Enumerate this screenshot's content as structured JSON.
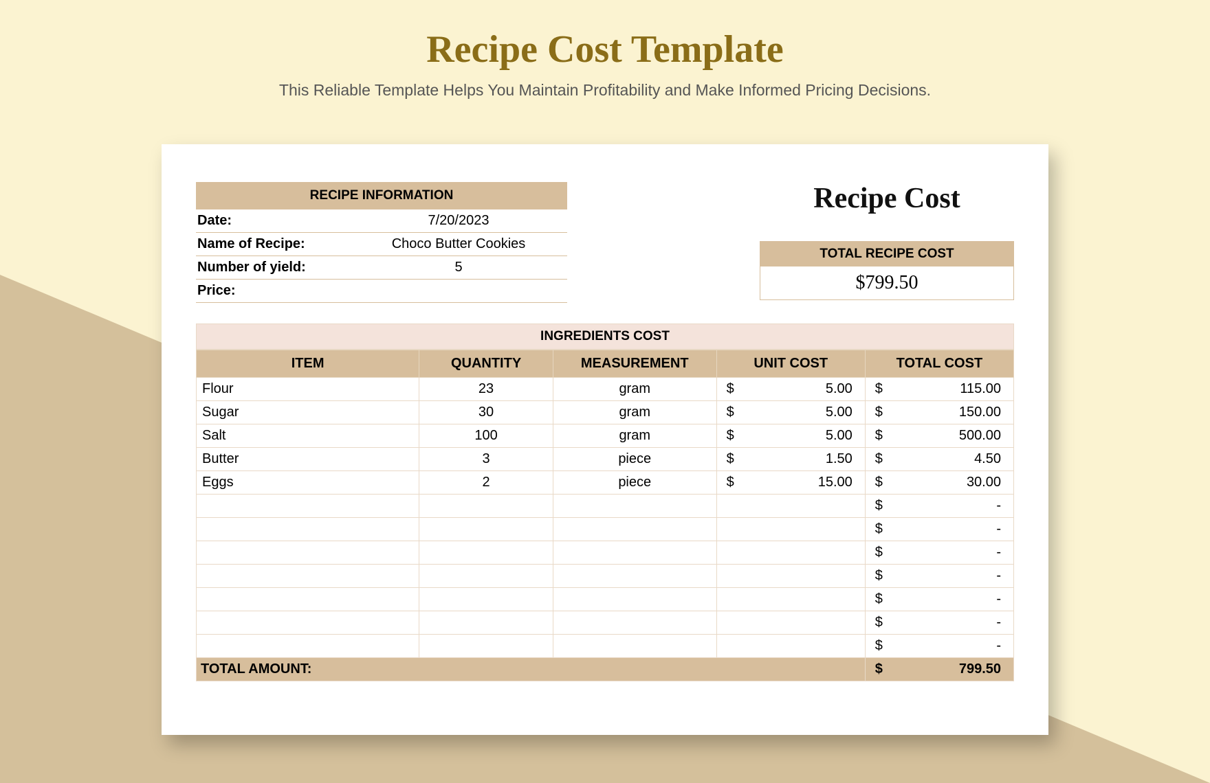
{
  "page": {
    "title": "Recipe Cost Template",
    "subtitle": "This Reliable Template Helps You Maintain Profitability and Make Informed Pricing Decisions."
  },
  "info": {
    "header": "RECIPE INFORMATION",
    "date_label": "Date:",
    "date_value": "7/20/2023",
    "name_label": "Name of Recipe:",
    "name_value": "Choco Butter Cookies",
    "yield_label": "Number of yield:",
    "yield_value": "5",
    "price_label": "Price:",
    "price_value": ""
  },
  "summary": {
    "title": "Recipe Cost",
    "total_label": "TOTAL RECIPE COST",
    "total_value": "$799.50"
  },
  "ingredients": {
    "section_title": "INGREDIENTS COST",
    "headers": {
      "item": "ITEM",
      "qty": "QUANTITY",
      "meas": "MEASUREMENT",
      "unit": "UNIT COST",
      "total": "TOTAL COST"
    },
    "rows": [
      {
        "item": "Flour",
        "qty": "23",
        "meas": "gram",
        "unit_sym": "$",
        "unit": "5.00",
        "tot_sym": "$",
        "tot": "115.00"
      },
      {
        "item": "Sugar",
        "qty": "30",
        "meas": "gram",
        "unit_sym": "$",
        "unit": "5.00",
        "tot_sym": "$",
        "tot": "150.00"
      },
      {
        "item": "Salt",
        "qty": "100",
        "meas": "gram",
        "unit_sym": "$",
        "unit": "5.00",
        "tot_sym": "$",
        "tot": "500.00"
      },
      {
        "item": "Butter",
        "qty": "3",
        "meas": "piece",
        "unit_sym": "$",
        "unit": "1.50",
        "tot_sym": "$",
        "tot": "4.50"
      },
      {
        "item": "Eggs",
        "qty": "2",
        "meas": "piece",
        "unit_sym": "$",
        "unit": "15.00",
        "tot_sym": "$",
        "tot": "30.00"
      },
      {
        "item": "",
        "qty": "",
        "meas": "",
        "unit_sym": "",
        "unit": "",
        "tot_sym": "$",
        "tot": "-"
      },
      {
        "item": "",
        "qty": "",
        "meas": "",
        "unit_sym": "",
        "unit": "",
        "tot_sym": "$",
        "tot": "-"
      },
      {
        "item": "",
        "qty": "",
        "meas": "",
        "unit_sym": "",
        "unit": "",
        "tot_sym": "$",
        "tot": "-"
      },
      {
        "item": "",
        "qty": "",
        "meas": "",
        "unit_sym": "",
        "unit": "",
        "tot_sym": "$",
        "tot": "-"
      },
      {
        "item": "",
        "qty": "",
        "meas": "",
        "unit_sym": "",
        "unit": "",
        "tot_sym": "$",
        "tot": "-"
      },
      {
        "item": "",
        "qty": "",
        "meas": "",
        "unit_sym": "",
        "unit": "",
        "tot_sym": "$",
        "tot": "-"
      },
      {
        "item": "",
        "qty": "",
        "meas": "",
        "unit_sym": "",
        "unit": "",
        "tot_sym": "$",
        "tot": "-"
      }
    ],
    "footer": {
      "label": "TOTAL AMOUNT:",
      "sym": "$",
      "value": "799.50"
    }
  }
}
